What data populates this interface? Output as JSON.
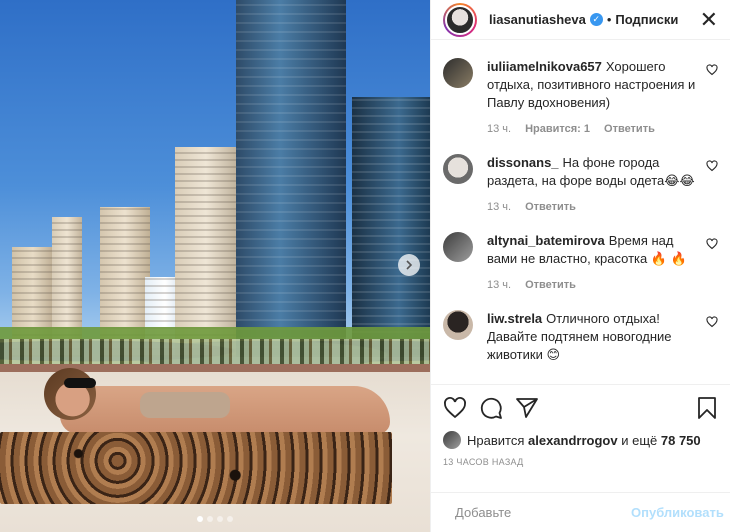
{
  "post": {
    "image_alt": "beach photo",
    "carousel_dots": 4,
    "active_dot": 0
  },
  "header": {
    "username": "liasanutiasheva",
    "separator": "•",
    "follow_label": "Подписки",
    "close_icon": "close-icon"
  },
  "comments": [
    {
      "user": "iuliiamelnikova657",
      "text": "Хорошего отдыха, позитивного настроения и Павлу вдохновения)",
      "time": "13 ч.",
      "likes": "Нравится: 1",
      "reply": "Ответить"
    },
    {
      "user": "dissonans_",
      "text": "На фоне города раздета, на форе воды одета😂😂",
      "time": "13 ч.",
      "likes": "",
      "reply": "Ответить"
    },
    {
      "user": "altynai_batemirova",
      "text": "Время над вами не властно, красотка 🔥 🔥",
      "time": "13 ч.",
      "likes": "",
      "reply": "Ответить"
    },
    {
      "user": "liw.strela",
      "text": "Отличного отдыха! Давайте подтянем новогодние животики 😊",
      "time": "",
      "likes": "",
      "reply": ""
    }
  ],
  "actions": {
    "like_icon": "heart-icon",
    "comment_icon": "comment-icon",
    "share_icon": "share-icon",
    "save_icon": "bookmark-icon"
  },
  "likes": {
    "prefix": "Нравится",
    "user": "alexandrrogov",
    "suffix": "и ещё",
    "count": "78 750"
  },
  "time_ago": "13 ЧАСОВ НАЗАД",
  "add_comment": {
    "placeholder": "Добавьте",
    "publish_label": "Опубликовать"
  },
  "colors": {
    "verified": "#3897f0",
    "publish_disabled": "#b2dffc",
    "muted": "#8e8e8e"
  }
}
